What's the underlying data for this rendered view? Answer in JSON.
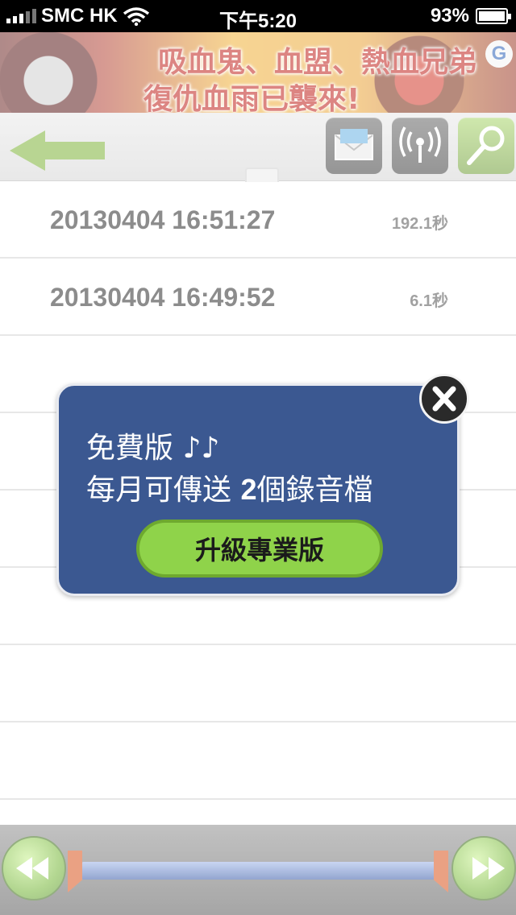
{
  "status_bar": {
    "carrier": "SMC HK",
    "time": "下午5:20",
    "battery": "93%"
  },
  "ad_banner": {
    "line1": "吸血鬼、血盟、熱血兄弟",
    "line2": "復仇血雨已襲來!"
  },
  "toolbar": {
    "back": "back-arrow-icon",
    "buttons": [
      "mail-icon",
      "broadcast-icon",
      "search-icon"
    ]
  },
  "recordings": [
    {
      "timestamp": "20130404 16:51:27",
      "duration": "192.1秒"
    },
    {
      "timestamp": "20130404 16:49:52",
      "duration": "6.1秒"
    }
  ],
  "popup": {
    "line1": "免費版 ♪♪",
    "line2_prefix": "每月可傳送 ",
    "line2_count": "2",
    "line2_suffix": "個錄音檔",
    "upgrade_label": "升級專業版",
    "close_icon": "close-icon"
  },
  "player": {
    "rewind": "rewind-icon",
    "fast_forward": "fast-forward-icon"
  },
  "colors": {
    "popup_bg": "#3b5891",
    "upgrade_green": "#8fd34a",
    "progress_blue": "#3a5ca8",
    "marker_orange": "#d9551e"
  }
}
